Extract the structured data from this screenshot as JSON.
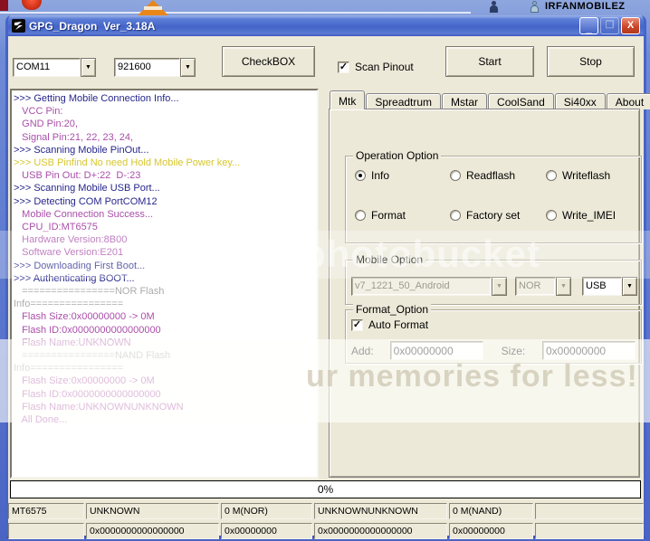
{
  "desktop": {
    "user_label": "IRFANMOBILEZ"
  },
  "window": {
    "title": "GPG_Dragon  Ver_3.18A",
    "minimize_glyph": "_",
    "close_glyph": "X"
  },
  "toolbar": {
    "port_select": "COM11",
    "baud_select": "921600",
    "checkbox_button": "CheckBOX",
    "scan_pinout_label": "Scan Pinout",
    "scan_pinout_checked": true,
    "start_button": "Start",
    "stop_button": "Stop"
  },
  "log": {
    "lines": [
      {
        "text": ">>> Getting Mobile Connection Info...",
        "color": "navy"
      },
      {
        "text": "   VCC Pin:",
        "color": "purple"
      },
      {
        "text": "   GND Pin:20,",
        "color": "purple"
      },
      {
        "text": "   Signal Pin:21, 22, 23, 24,",
        "color": "purple"
      },
      {
        "text": ">>> Scanning Mobile PinOut...",
        "color": "navy"
      },
      {
        "text": ">>> USB Pinfind No need Hold Mobile Power key...",
        "color": "yellow"
      },
      {
        "text": "   USB Pin Out: D+:22  D-:23",
        "color": "purple"
      },
      {
        "text": ">>> Scanning Mobile USB Port...",
        "color": "navy"
      },
      {
        "text": ">>> Detecting COM PortCOM12",
        "color": "navy"
      },
      {
        "text": "   Mobile Connection Success...",
        "color": "purple"
      },
      {
        "text": "   CPU_ID:MT6575",
        "color": "purple"
      },
      {
        "text": "   Hardware Version:8B00",
        "color": "purple"
      },
      {
        "text": "   Software Version:E201",
        "color": "purple"
      },
      {
        "text": ">>> Downloading First Boot...",
        "color": "navy"
      },
      {
        "text": ">>> Authenticating BOOT...",
        "color": "navy"
      },
      {
        "text": "   ================NOR Flash",
        "color": "gray"
      },
      {
        "text": "Info================",
        "color": "gray"
      },
      {
        "text": "   Flash Size:0x00000000 -> 0M",
        "color": "purple"
      },
      {
        "text": "   Flash ID:0x0000000000000000",
        "color": "purple"
      },
      {
        "text": "   Flash Name:UNKNOWN",
        "color": "purple"
      },
      {
        "text": "   ================NAND Flash",
        "color": "gray"
      },
      {
        "text": "Info================",
        "color": "gray"
      },
      {
        "text": "   Flash Size:0x00000000 -> 0M",
        "color": "purple"
      },
      {
        "text": "   Flash ID:0x0000000000000000",
        "color": "purple"
      },
      {
        "text": "   Flash Name:UNKNOWNUNKNOWN",
        "color": "purple"
      },
      {
        "text": "   All Done...",
        "color": "purple"
      }
    ]
  },
  "tabs": {
    "items": [
      {
        "label": "Mtk",
        "active": true
      },
      {
        "label": "Spreadtrum",
        "active": false
      },
      {
        "label": "Mstar",
        "active": false
      },
      {
        "label": "CoolSand",
        "active": false
      },
      {
        "label": "Si40xx",
        "active": false
      },
      {
        "label": "About US",
        "active": false
      }
    ]
  },
  "operation_option": {
    "title": "Operation Option",
    "radios": [
      {
        "label": "Info",
        "selected": true
      },
      {
        "label": "Readflash",
        "selected": false
      },
      {
        "label": "Writeflash",
        "selected": false
      },
      {
        "label": "Format",
        "selected": false
      },
      {
        "label": "Factory set",
        "selected": false
      },
      {
        "label": "Write_IMEI",
        "selected": false
      }
    ]
  },
  "mobile_option": {
    "title": "Mobile Option",
    "boot_select": "v7_1221_50_Android",
    "flash_select": "NOR",
    "connection_select": "USB"
  },
  "format_option": {
    "title": "Format_Option",
    "auto_format_label": "Auto Format",
    "auto_format_checked": true,
    "add_label": "Add:",
    "add_value": "0x00000000",
    "size_label": "Size:",
    "size_value": "0x00000000"
  },
  "progress": {
    "value": "0%"
  },
  "status_bar": {
    "row1": [
      "MT6575",
      "UNKNOWN",
      "0 M(NOR)",
      "UNKNOWNUNKNOWN",
      "0 M(NAND)",
      ""
    ],
    "row2": [
      "",
      "0x0000000000000000",
      "0x00000000",
      "0x0000000000000000",
      "0x00000000",
      ""
    ]
  },
  "watermark": {
    "band1_text": "photobucket",
    "band2_text": "ur memories for less!"
  },
  "colors": {
    "navy": "#26268C",
    "purple": "#A94FA9",
    "yellow": "#D6C62E",
    "gray": "#ABABAB",
    "face": "#ECE9D8",
    "title_blue": "#4465C8"
  }
}
